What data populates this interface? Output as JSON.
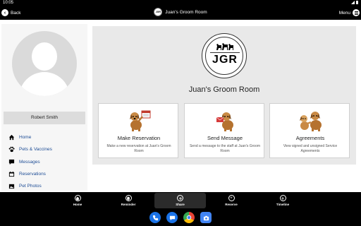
{
  "status_bar": {
    "time": "10:05"
  },
  "app_bar": {
    "back_label": "Back",
    "title": "Juan's Groom Room",
    "menu_label": "Menu",
    "logo_text": "JGR"
  },
  "sidebar": {
    "user_name": "Robert Smith",
    "items": [
      {
        "label": "Home",
        "icon": "home-icon"
      },
      {
        "label": "Pets & Vaccines",
        "icon": "paw-icon"
      },
      {
        "label": "Messages",
        "icon": "chat-icon"
      },
      {
        "label": "Reservations",
        "icon": "calendar-icon"
      },
      {
        "label": "Pet Photos",
        "icon": "photo-icon"
      }
    ]
  },
  "main": {
    "logo_text": "JGR",
    "business_name": "Juan's Groom Room",
    "cards": [
      {
        "title": "Make Reservation",
        "description": "Make a new reservation at Juan's Groom Room"
      },
      {
        "title": "Send Message",
        "description": "Send a message to the staff at Juan's Groom Room"
      },
      {
        "title": "Agreements",
        "description": "View signed and unsigned Service Agreements"
      }
    ]
  },
  "tab_bar": {
    "tabs": [
      {
        "label": "Home",
        "icon": "home-icon"
      },
      {
        "label": "Reminder",
        "icon": "bell-icon"
      },
      {
        "label": "Share",
        "icon": "share-icon",
        "active": true
      },
      {
        "label": "Reserve",
        "icon": "plus-icon"
      },
      {
        "label": "Timeline",
        "icon": "timeline-icon"
      }
    ]
  },
  "dock": {
    "apps": [
      {
        "name": "phone-icon",
        "color": "#1a73e8"
      },
      {
        "name": "messages-icon",
        "color": "#1a73e8"
      },
      {
        "name": "chrome-icon",
        "color": "#ea4335"
      },
      {
        "name": "camera-icon",
        "color": "#4285f4"
      }
    ]
  },
  "colors": {
    "nav_link": "#1f4e96",
    "bar_background": "#000000",
    "panel_background": "#e9e9e9"
  }
}
